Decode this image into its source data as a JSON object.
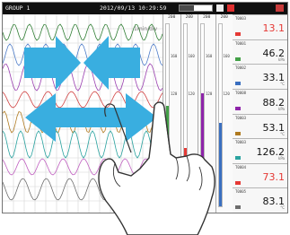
{
  "status_bar": {
    "group_label": "GROUP 1",
    "datetime": "2012/09/13 10:29:59",
    "progress_fraction": 0.45,
    "icon_names": [
      "screen-icon",
      "alarm-icon",
      "menu-icon"
    ]
  },
  "trend": {
    "scale_label": "1min/div",
    "grid": true,
    "channel_colors": [
      "#2e7d32",
      "#4e7cc9",
      "#9a3fb0",
      "#d04040",
      "#b07a20",
      "#2ba3a0",
      "#c060c0",
      "#6d6d6d"
    ]
  },
  "bargraph": {
    "columns": [
      {
        "scale_top": "200",
        "scale_mid": "160",
        "scale_low": "120",
        "level": 0.55,
        "color": "#43a047"
      },
      {
        "scale_top": "200",
        "scale_mid": "160",
        "scale_low": "120",
        "level": 0.32,
        "color": "#e53935"
      },
      {
        "scale_top": "200",
        "scale_mid": "160",
        "scale_low": "120",
        "level": 0.62,
        "color": "#8e24aa"
      },
      {
        "scale_top": "200",
        "scale_mid": "160",
        "scale_low": "120",
        "level": 0.46,
        "color": "#3a6fc0"
      }
    ]
  },
  "digital": {
    "channels": [
      {
        "tag": "T0003",
        "value": "13.1",
        "unit": "",
        "color": "#e53935",
        "swatch": "#e53935"
      },
      {
        "tag": "T0001",
        "value": "46.2",
        "unit": "kPa",
        "color": "#111111",
        "swatch": "#43a047"
      },
      {
        "tag": "T0002",
        "value": "33.1",
        "unit": "°C",
        "color": "#111111",
        "swatch": "#3a6fc0"
      },
      {
        "tag": "T0008",
        "value": "88.2",
        "unit": "kPa",
        "color": "#111111",
        "swatch": "#8e24aa"
      },
      {
        "tag": "T0003",
        "value": "53.1",
        "unit": "°C",
        "color": "#111111",
        "swatch": "#b07a20"
      },
      {
        "tag": "T0003",
        "value": "126.2",
        "unit": "kPa",
        "color": "#111111",
        "swatch": "#2ba3a0"
      },
      {
        "tag": "T0004",
        "value": "73.1",
        "unit": "",
        "color": "#e53935",
        "swatch": "#e53935"
      },
      {
        "tag": "T0005",
        "value": "83.1",
        "unit": "°C",
        "color": "#111111",
        "swatch": "#6d6d6d"
      }
    ]
  },
  "overlay": {
    "pinch_arrow_color": "#39aee0",
    "pan_arrow_color": "#39aee0",
    "gesture_icon": "hand-pinch-icon"
  }
}
